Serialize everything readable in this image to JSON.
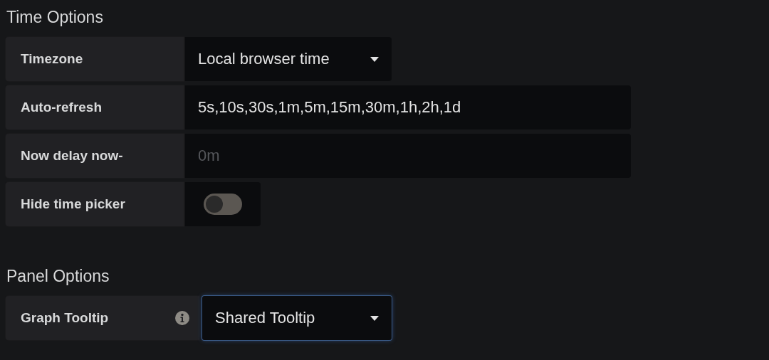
{
  "sections": [
    {
      "title": "Time Options",
      "rows": [
        {
          "kind": "select",
          "label": "Timezone",
          "value": "Local browser time",
          "focused": false
        },
        {
          "kind": "input",
          "label": "Auto-refresh",
          "value": "5s,10s,30s,1m,5m,15m,30m,1h,2h,1d"
        },
        {
          "kind": "input",
          "label": "Now delay now-",
          "placeholder": "0m"
        },
        {
          "kind": "switch",
          "label": "Hide time picker",
          "on": false
        }
      ]
    },
    {
      "title": "Panel Options",
      "rows": [
        {
          "kind": "select",
          "label": "Graph Tooltip",
          "info": true,
          "value": "Shared Tooltip",
          "focused": true
        }
      ]
    }
  ]
}
